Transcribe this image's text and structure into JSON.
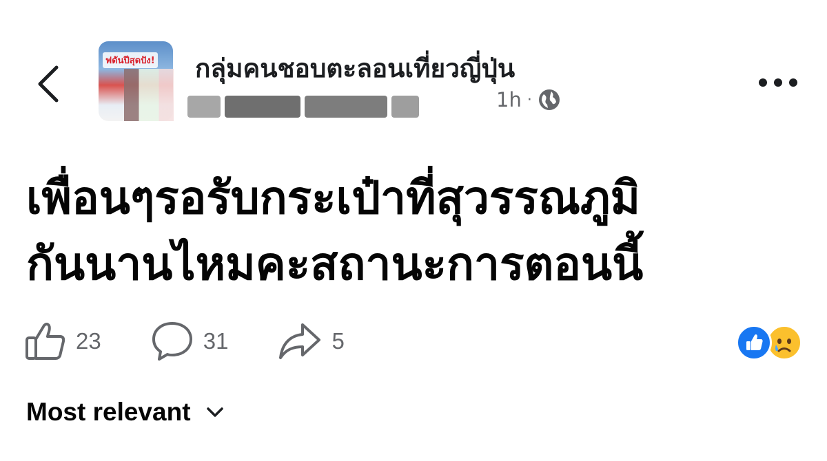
{
  "header": {
    "back_icon": "chevron-left-icon",
    "group_name": "กลุ่มคนชอบตะลอนเที่ยวญี่ปุ่น",
    "group_thumb_text": "ฟดันปีสุดปัง!",
    "time": "1h",
    "audience_icon": "globe-icon",
    "more_icon": "more-horizontal-icon"
  },
  "post": {
    "lines": [
      "เพื่อนๆรอรับกระเป๋าที่สุวรรณภูมิ",
      "กันนานไหมคะสถานะการตอนนี้"
    ]
  },
  "actions": {
    "like_count": "23",
    "comment_count": "31",
    "share_count": "5"
  },
  "reactions": [
    "like",
    "sad"
  ],
  "sort": {
    "label": "Most relevant"
  },
  "colors": {
    "accent": "#1877f2",
    "secondary_text": "#65676b",
    "primary_text": "#050505"
  }
}
